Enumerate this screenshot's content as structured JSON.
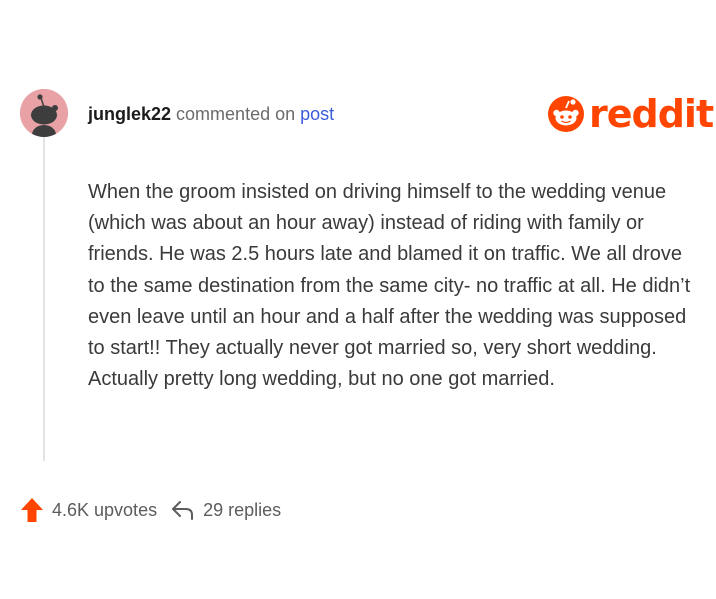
{
  "comment": {
    "username": "junglek22",
    "commented_text": "commented on",
    "post_link": "post",
    "body": "When the groom insisted on driving himself to the wedding venue (which was about an hour away) instead of riding with family or friends. He was 2.5 hours late and blamed it on traffic. We all drove to the same destination from the same city- no traffic at all. He didn’t even leave until an hour and a half after the wedding was supposed to start!! They actually never got married so, very short wedding. Actually pretty long wedding, but no one got married."
  },
  "brand": {
    "logo_text": "reddit",
    "color": "#ff4500"
  },
  "footer": {
    "upvotes": "4.6K upvotes",
    "replies": "29 replies"
  },
  "icons": {
    "avatar": "snoo-avatar-icon",
    "logo": "reddit-snoo-icon",
    "upvote": "upvote-arrow-icon",
    "reply": "reply-arrow-icon"
  },
  "colors": {
    "avatar_bg": "#e8a1a5",
    "link": "#3b5bdb",
    "upvote": "#ff4500"
  }
}
